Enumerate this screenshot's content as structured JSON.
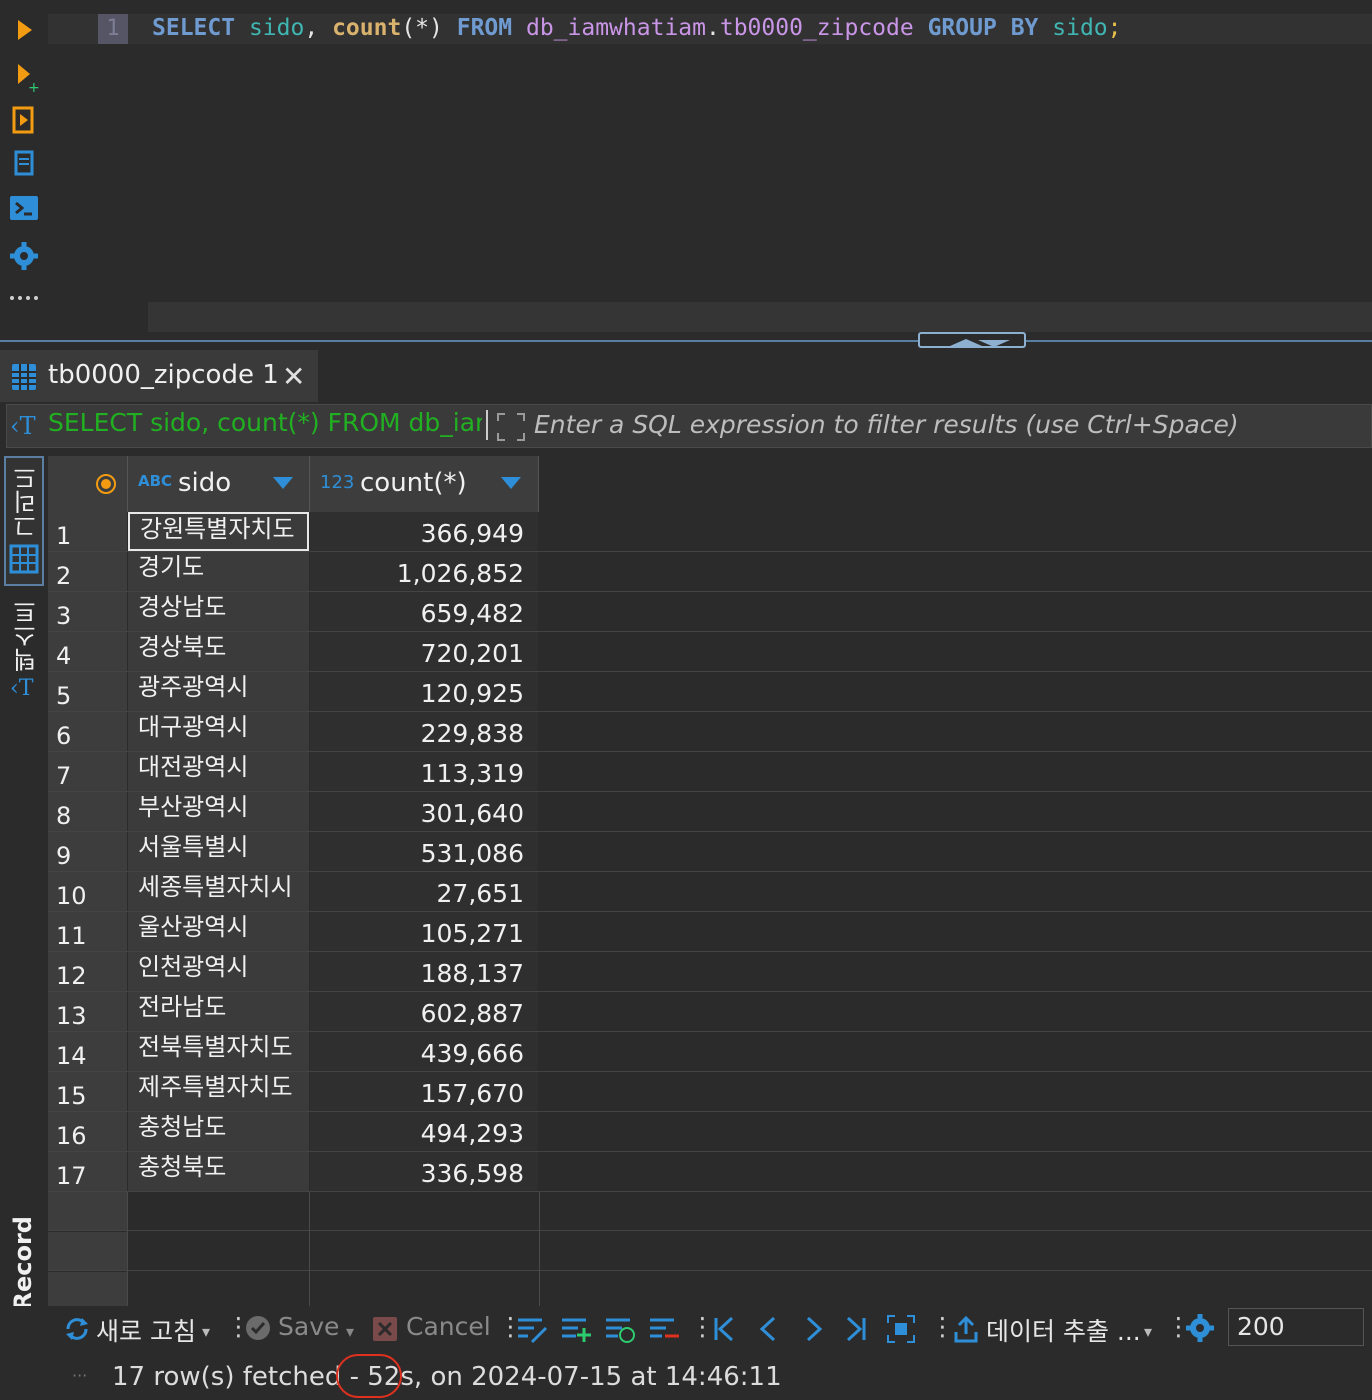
{
  "editor": {
    "line_number": "1",
    "sql": {
      "select": "SELECT",
      "col1": "sido",
      "comma": ",",
      "fn": "count",
      "fn_args": "(*)",
      "from": "FROM",
      "db": "db_iamwhatiam",
      "dot": ".",
      "table": "tb0000_zipcode",
      "group": "GROUP",
      "by": "BY",
      "col2": "sido",
      "semi": ";"
    }
  },
  "results": {
    "tab_label": "tb0000_zipcode 1",
    "filter_query": "SELECT sido, count(*) FROM db_iar",
    "filter_placeholder": "Enter a SQL expression to filter results (use Ctrl+Space)",
    "side_tabs": {
      "grid": "그리드",
      "text": "텍스트",
      "record": "Record"
    },
    "columns": [
      {
        "type_label": "ABC",
        "name": "sido"
      },
      {
        "type_label": "123",
        "name": "count(*)"
      }
    ],
    "rows": [
      {
        "n": "1",
        "sido": "강원특별자치도",
        "count": "366,949"
      },
      {
        "n": "2",
        "sido": "경기도",
        "count": "1,026,852"
      },
      {
        "n": "3",
        "sido": "경상남도",
        "count": "659,482"
      },
      {
        "n": "4",
        "sido": "경상북도",
        "count": "720,201"
      },
      {
        "n": "5",
        "sido": "광주광역시",
        "count": "120,925"
      },
      {
        "n": "6",
        "sido": "대구광역시",
        "count": "229,838"
      },
      {
        "n": "7",
        "sido": "대전광역시",
        "count": "113,319"
      },
      {
        "n": "8",
        "sido": "부산광역시",
        "count": "301,640"
      },
      {
        "n": "9",
        "sido": "서울특별시",
        "count": "531,086"
      },
      {
        "n": "10",
        "sido": "세종특별자치시",
        "count": "27,651"
      },
      {
        "n": "11",
        "sido": "울산광역시",
        "count": "105,271"
      },
      {
        "n": "12",
        "sido": "인천광역시",
        "count": "188,137"
      },
      {
        "n": "13",
        "sido": "전라남도",
        "count": "602,887"
      },
      {
        "n": "14",
        "sido": "전북특별자치도",
        "count": "439,666"
      },
      {
        "n": "15",
        "sido": "제주특별자치도",
        "count": "157,670"
      },
      {
        "n": "16",
        "sido": "충청남도",
        "count": "494,293"
      },
      {
        "n": "17",
        "sido": "충청북도",
        "count": "336,598"
      }
    ]
  },
  "toolbar": {
    "refresh_label": "새로 고침",
    "save_label": "Save",
    "cancel_label": "Cancel",
    "export_label": "데이터 추출 ...",
    "fetch_size": "200"
  },
  "status": {
    "rows_text": "17 row(s) fetched -",
    "duration": "52s,",
    "timestamp_text": "on 2024-07-15 at 14:46:11"
  },
  "colors": {
    "keyword": "#6f9bd1",
    "column": "#3fb6b2",
    "function": "#d9b26d",
    "table": "#c995e6",
    "filter_query": "#21b021",
    "accent_blue": "#2e8fd8",
    "highlight_red": "#e0301e"
  }
}
